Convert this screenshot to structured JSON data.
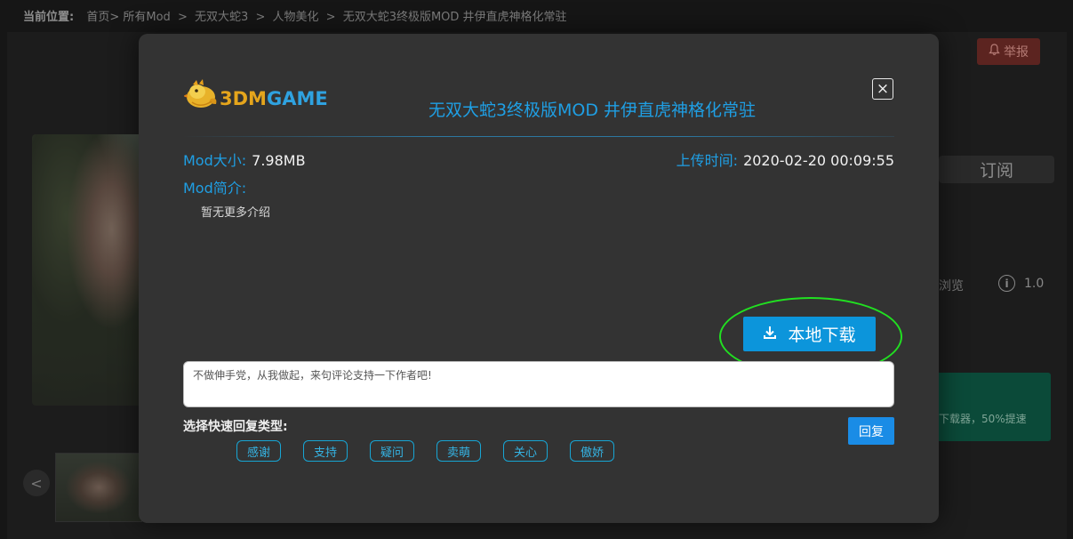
{
  "breadcrumb": {
    "label": "当前位置:",
    "items": [
      "首页>",
      "所有Mod",
      ">",
      "无双大蛇3",
      ">",
      "人物美化",
      ">",
      "无双大蛇3终极版MOD 井伊直虎神格化常驻"
    ]
  },
  "background": {
    "report_label": "举报",
    "subscribe_label": "订阅",
    "views_text": "浏览",
    "version_text": "1.0",
    "promo_text": "下载器，50%提速",
    "prev_arrow": "<"
  },
  "modal": {
    "logo": {
      "part1": "3",
      "part2": "DM",
      "part3": "GAME"
    },
    "title": "无双大蛇3终极版MOD 井伊直虎神格化常驻",
    "close_glyph": "×",
    "size_label": "Mod大小:",
    "size_value": "7.98MB",
    "upload_label": "上传时间:",
    "upload_value": "2020-02-20 00:09:55",
    "desc_label": "Mod简介:",
    "desc_text": "暂无更多介绍",
    "download_label": "本地下载",
    "comment_placeholder": "不做伸手党，从我做起，来句评论支持一下作者吧!",
    "quick_reply_label": "选择快速回复类型:",
    "reply_button": "回复",
    "quick_tags": [
      "感谢",
      "支持",
      "疑问",
      "卖萌",
      "关心",
      "傲娇"
    ]
  },
  "colors": {
    "accent_blue": "#1f9fe4",
    "download_blue": "#0c95db",
    "highlight_green": "#21e021",
    "modal_bg": "#333333"
  },
  "icons": [
    "bell-icon",
    "info-icon",
    "download-icon",
    "close-icon",
    "logo-bird-icon"
  ]
}
